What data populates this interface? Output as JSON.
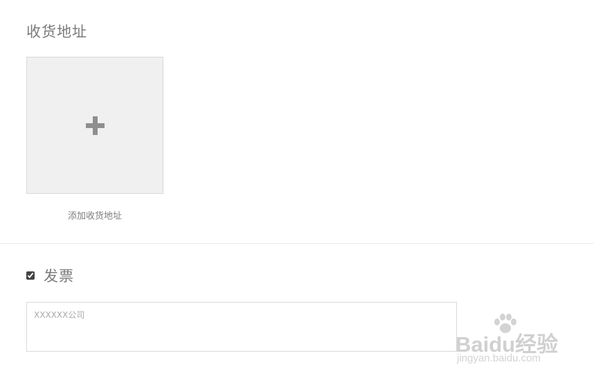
{
  "address": {
    "title": "收货地址",
    "add_label": "添加收货地址"
  },
  "invoice": {
    "title": "发票",
    "checked": true,
    "placeholder": "XXXXXX公司"
  },
  "watermark": {
    "logo_text": "Baidu经验",
    "url": "jingyan.baidu.com"
  }
}
